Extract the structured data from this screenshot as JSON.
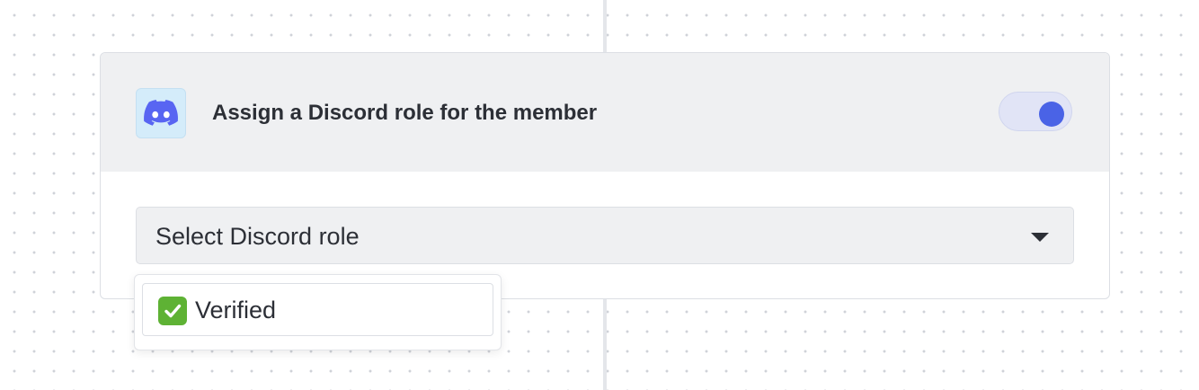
{
  "colors": {
    "canvas_dot": "#cfd2d8",
    "card_header_bg": "#eff0f2",
    "discord_badge_bg": "#d4ecfa",
    "discord_brand": "#5865f2",
    "toggle_track": "#e1e4f6",
    "toggle_knob": "#4a63e6",
    "text": "#2c2f36",
    "check_green": "#5eb234"
  },
  "action_card": {
    "icon": "discord-icon",
    "title": "Assign a Discord role for the member",
    "enabled": true,
    "role_select": {
      "placeholder": "Select Discord role",
      "icon": "caret-down-icon",
      "expanded": true
    }
  },
  "dropdown": {
    "options": [
      {
        "icon": "check-mark-icon",
        "label": "Verified"
      }
    ]
  }
}
